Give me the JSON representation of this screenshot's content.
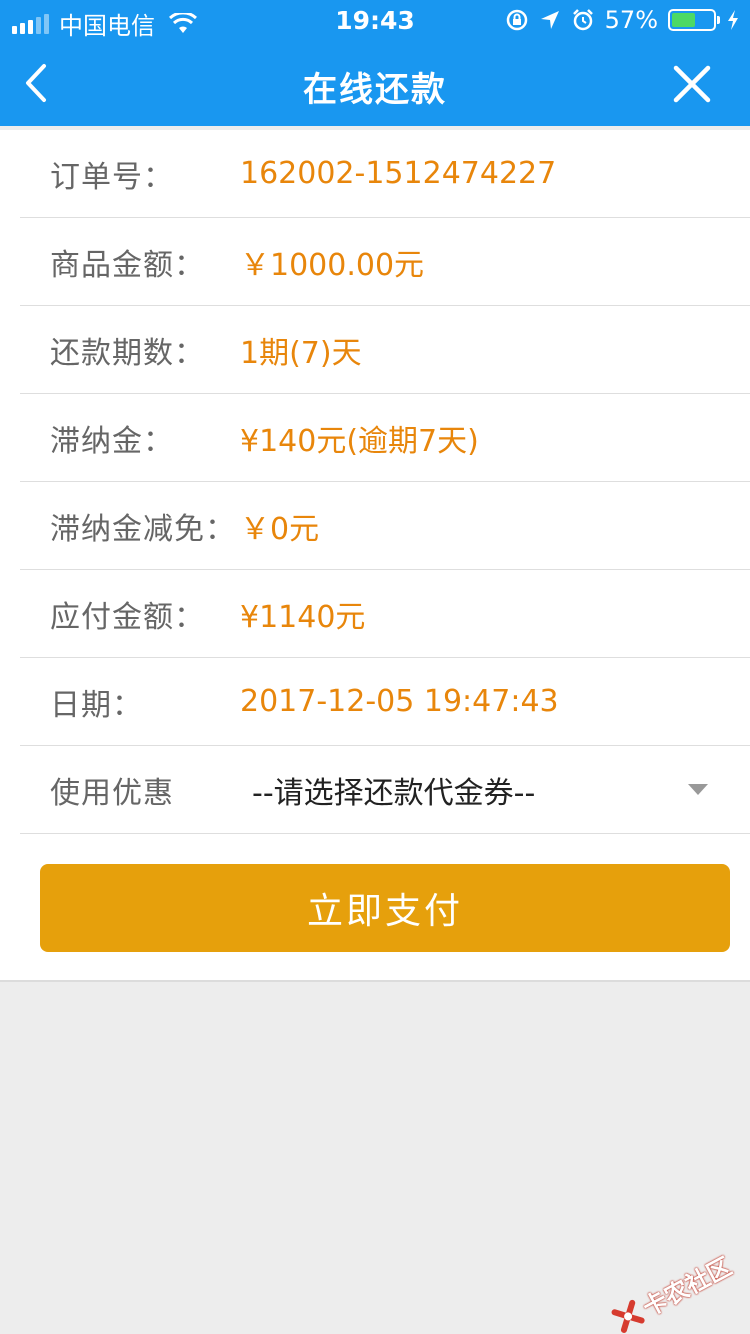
{
  "status_bar": {
    "carrier": "中国电信",
    "time": "19:43",
    "battery_pct": "57%",
    "battery_level": 0.57,
    "icons": [
      "signal-icon",
      "wifi-icon",
      "rotation-lock-icon",
      "location-icon",
      "alarm-icon",
      "battery-icon",
      "charging-icon"
    ]
  },
  "nav": {
    "title": "在线还款",
    "back_icon": "chevron-left-icon",
    "close_icon": "close-icon",
    "bg_color": "#1997f0"
  },
  "details": [
    {
      "label": "订单号：",
      "value": "162002-1512474227"
    },
    {
      "label": "商品金额：",
      "value": "￥1000.00元"
    },
    {
      "label": "还款期数：",
      "value": "1期(7)天"
    },
    {
      "label": "滞纳金：",
      "value": "¥140元(逾期7天)"
    },
    {
      "label": "滞纳金减免：",
      "value": "￥0元"
    },
    {
      "label": "应付金额：",
      "value": "¥1140元"
    },
    {
      "label": "日期：",
      "value": "2017-12-05 19:47:43"
    }
  ],
  "coupon": {
    "label": "使用优惠",
    "selected": "--请选择还款代金券--"
  },
  "pay_button": {
    "label": "立即支付",
    "color": "#e6a00c"
  },
  "value_color": "#e8860b",
  "watermark": {
    "text": "卡农社区"
  }
}
